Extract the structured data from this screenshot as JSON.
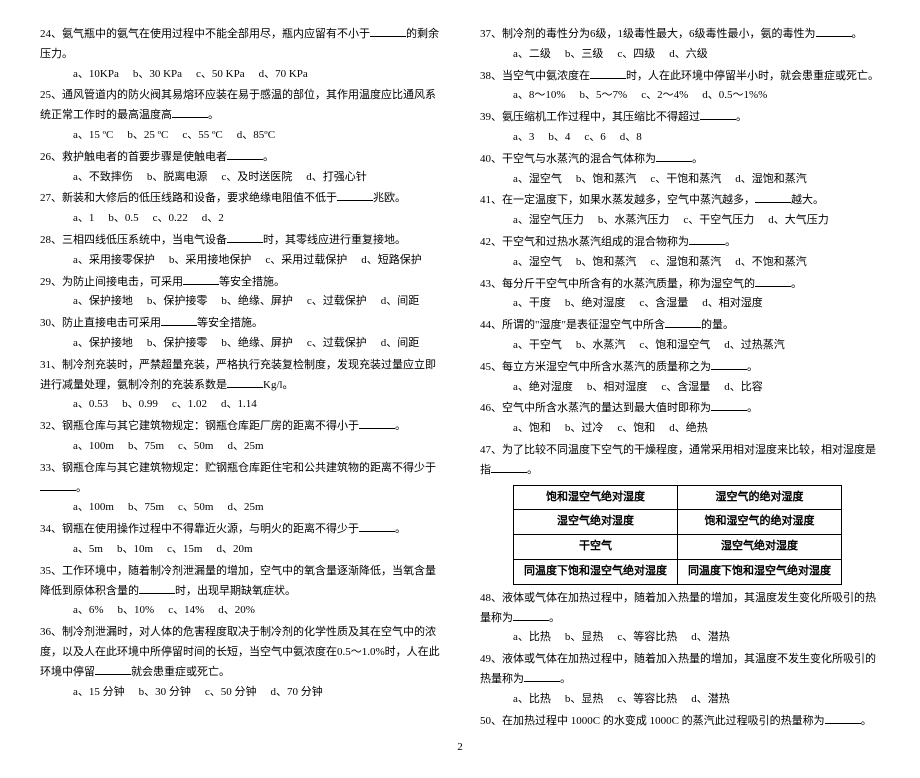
{
  "page_number": "2",
  "table47": {
    "c11": "饱和湿空气绝对湿度",
    "c12": "湿空气的绝对湿度",
    "c21": "湿空气绝对湿度",
    "c22": "饱和湿空气的绝对湿度",
    "c31": "干空气",
    "c32": "湿空气绝对湿度",
    "c41": "同温度下饱和湿空气绝对湿度",
    "c42": "同温度下饱和湿空气绝对湿度"
  },
  "left": [
    {
      "n": "24",
      "stem": "氨气瓶中的氨气在使用过程中不能全部用尽，瓶内应留有不小于______的剩余压力。",
      "opts": [
        "a、10KPa",
        "b、30 KPa",
        "c、50 KPa",
        "d、70 KPa"
      ]
    },
    {
      "n": "25",
      "stem": "通风管道内的防火阀其易熔环应装在易于感温的部位，其作用温度应比通风系统正常工作时的最高温度高______。",
      "opts": [
        "a、15 ºC",
        "b、25 ºC",
        "c、55 ºC",
        "d、85ºC"
      ]
    },
    {
      "n": "26",
      "stem": "救护触电者的首要步骤是使触电者______。",
      "opts": [
        "a、不致摔伤",
        "b、脱离电源",
        "c、及时送医院",
        "d、打强心针"
      ]
    },
    {
      "n": "27",
      "stem": "新装和大修后的低压线路和设备，要求绝缘电阻值不低于______兆欧。",
      "opts": [
        "a、1",
        "b、0.5",
        "c、0.22",
        "d、2"
      ]
    },
    {
      "n": "28",
      "stem": "三相四线低压系统中，当电气设备______时，其零线应进行重复接地。",
      "opts": [
        "a、采用接零保护",
        "b、采用接地保护",
        "c、采用过载保护",
        "d、短路保护"
      ]
    },
    {
      "n": "29",
      "stem": "为防止间接电击，可采用______等安全措施。",
      "opts": [
        "a、保护接地",
        "b、保护接零",
        "b、绝缘、屏护",
        "c、过载保护",
        "d、间距"
      ]
    },
    {
      "n": "30",
      "stem": "防止直接电击可采用______等安全措施。",
      "opts": [
        "a、保护接地",
        "b、保护接零",
        "b、绝缘、屏护",
        "c、过载保护",
        "d、间距"
      ]
    },
    {
      "n": "31",
      "stem": "制冷剂充装时，严禁超量充装，严格执行充装复检制度，发现充装过量应立即进行减量处理，氨制冷剂的充装系数是______Kg/l。",
      "opts": [
        "a、0.53",
        "b、0.99",
        "c、1.02",
        "d、1.14"
      ]
    },
    {
      "n": "32",
      "stem": "钢瓶仓库与其它建筑物规定：钢瓶仓库距厂房的距离不得小于______。",
      "opts": [
        "a、100m",
        "b、75m",
        "c、50m",
        "d、25m"
      ]
    },
    {
      "n": "33",
      "stem": "钢瓶仓库与其它建筑物规定：贮钢瓶仓库距住宅和公共建筑物的距离不得少于______。",
      "opts": [
        "a、100m",
        "b、75m",
        "c、50m",
        "d、25m"
      ]
    },
    {
      "n": "34",
      "stem": "钢瓶在使用操作过程中不得靠近火源，与明火的距离不得少于______。",
      "opts": [
        "a、5m",
        "b、10m",
        "c、15m",
        "d、20m"
      ]
    },
    {
      "n": "35",
      "stem": "工作环境中，随着制冷剂泄漏量的增加，空气中的氧含量逐渐降低，当氧含量降低到原体积含量的______时，出现早期缺氧症状。",
      "opts": [
        "a、6%",
        "b、10%",
        "c、14%",
        "d、20%"
      ]
    },
    {
      "n": "36",
      "stem": "制冷剂泄漏时，对人体的危害程度取决于制冷剂的化学性质及其在空气中的浓度，以及人在此环境中所停留时间的长短，当空气中氨浓度在0.5～1.0%时，人在此环境中停留______就会患重症或死亡。",
      "opts": [
        "a、15 分钟",
        "b、30 分钟",
        "c、50 分钟",
        "d、70 分钟"
      ]
    }
  ],
  "right": [
    {
      "n": "37",
      "stem": "制冷剂的毒性分为6级，1级毒性最大，6级毒性最小，氨的毒性为______。",
      "opts": [
        "a、二级",
        "b、三级",
        "c、四级",
        "d、六级"
      ]
    },
    {
      "n": "38",
      "stem": "当空气中氨浓度在______时，人在此环境中停留半小时，就会患重症或死亡。",
      "opts": [
        "a、8～10%",
        "b、5～7%",
        "c、2～4%",
        "d、0.5～1%%"
      ]
    },
    {
      "n": "39",
      "stem": "氨压缩机工作过程中，其压缩比不得超过______。",
      "opts": [
        "a、3",
        "b、4",
        "c、6",
        "d、8"
      ]
    },
    {
      "n": "40",
      "stem": "干空气与水蒸汽的混合气体称为______。",
      "opts": [
        "a、湿空气",
        "b、饱和蒸汽",
        "c、干饱和蒸汽",
        "d、湿饱和蒸汽"
      ]
    },
    {
      "n": "41",
      "stem": "在一定温度下，如果水蒸发越多，空气中蒸汽越多，______越大。",
      "opts": [
        "a、湿空气压力",
        "b、水蒸汽压力",
        "c、干空气压力",
        "d、大气压力"
      ]
    },
    {
      "n": "42",
      "stem": "干空气和过热水蒸汽组成的混合物称为______。",
      "opts": [
        "a、湿空气",
        "b、饱和蒸汽",
        "c、湿饱和蒸汽",
        "d、不饱和蒸汽"
      ]
    },
    {
      "n": "43",
      "stem": "每分斤干空气中所含有的水蒸汽质量，称为湿空气的______。",
      "opts": [
        "a、干度",
        "b、绝对湿度",
        "c、含湿量",
        "d、相对湿度"
      ]
    },
    {
      "n": "44",
      "stem": "所谓的\"湿度\"是表征湿空气中所含______的量。",
      "opts": [
        "a、干空气",
        "b、水蒸汽",
        "c、饱和湿空气",
        "d、过热蒸汽"
      ]
    },
    {
      "n": "45",
      "stem": "每立方米湿空气中所含水蒸汽的质量称之为______。",
      "opts": [
        "a、绝对湿度",
        "b、相对湿度",
        "c、含湿量",
        "d、比容"
      ]
    },
    {
      "n": "46",
      "stem": "空气中所含水蒸汽的量达到最大值时即称为______。",
      "opts": [
        "a、饱和",
        "b、过冷",
        "c、饱和",
        "d、绝热"
      ]
    },
    {
      "n": "47",
      "stem": "为了比较不同温度下空气的干燥程度，通常采用相对湿度来比较，相对湿度是指______。",
      "table": true,
      "opts": []
    },
    {
      "n": "48",
      "stem": "液体或气体在加热过程中，随着加入热量的增加，其温度发生变化所吸引的热量称为______。",
      "opts": [
        "a、比热",
        "b、显热",
        "c、等容比热",
        "d、潜热"
      ]
    },
    {
      "n": "49",
      "stem": "液体或气体在加热过程中，随着加入热量的增加，其温度不发生变化所吸引的热量称为______。",
      "opts": [
        "a、比热",
        "b、显热",
        "c、等容比热",
        "d、潜热"
      ]
    },
    {
      "n": "50",
      "stem": "在加热过程中 1000C 的水变成 1000C 的蒸汽此过程吸引的热量称为______。",
      "opts": []
    }
  ]
}
